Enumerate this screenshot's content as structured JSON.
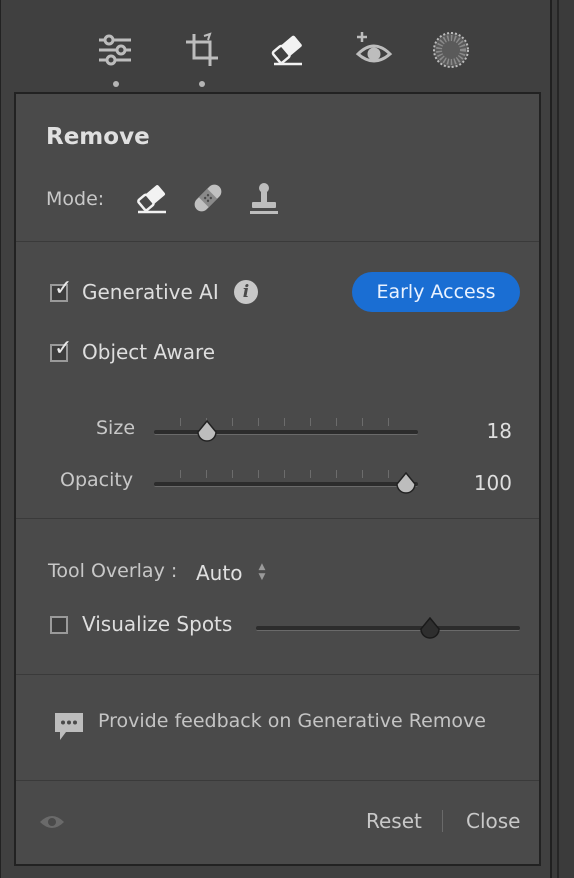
{
  "toolbar": {
    "tools": [
      {
        "icon": "sliders-icon",
        "label": "Edit"
      },
      {
        "icon": "crop-icon",
        "label": "Crop"
      },
      {
        "icon": "eraser-icon",
        "label": "Remove",
        "active": true
      },
      {
        "icon": "red-eye-icon",
        "label": "Red Eye"
      },
      {
        "icon": "masking-icon",
        "label": "Masking"
      }
    ]
  },
  "panel": {
    "title": "Remove",
    "mode_label": "Mode:",
    "modes": [
      "eraser-icon",
      "bandage-icon",
      "stamp-icon"
    ],
    "generative_ai": {
      "label": "Generative AI",
      "checked": true
    },
    "early_access_label": "Early Access",
    "object_aware": {
      "label": "Object Aware",
      "checked": true
    },
    "size": {
      "label": "Size",
      "value": "18",
      "fraction": 0.2
    },
    "opacity": {
      "label": "Opacity",
      "value": "100",
      "fraction": 1.0
    },
    "tool_overlay": {
      "label": "Tool Overlay :",
      "value": "Auto"
    },
    "visualize_spots": {
      "label": "Visualize Spots",
      "checked": false,
      "fraction": 0.66
    },
    "feedback_text": "Provide feedback on Generative Remove",
    "reset_label": "Reset",
    "close_label": "Close"
  },
  "colors": {
    "accent": "#1a6ed3",
    "panel_bg": "#4a4a4a",
    "outer_bg": "#404040"
  }
}
